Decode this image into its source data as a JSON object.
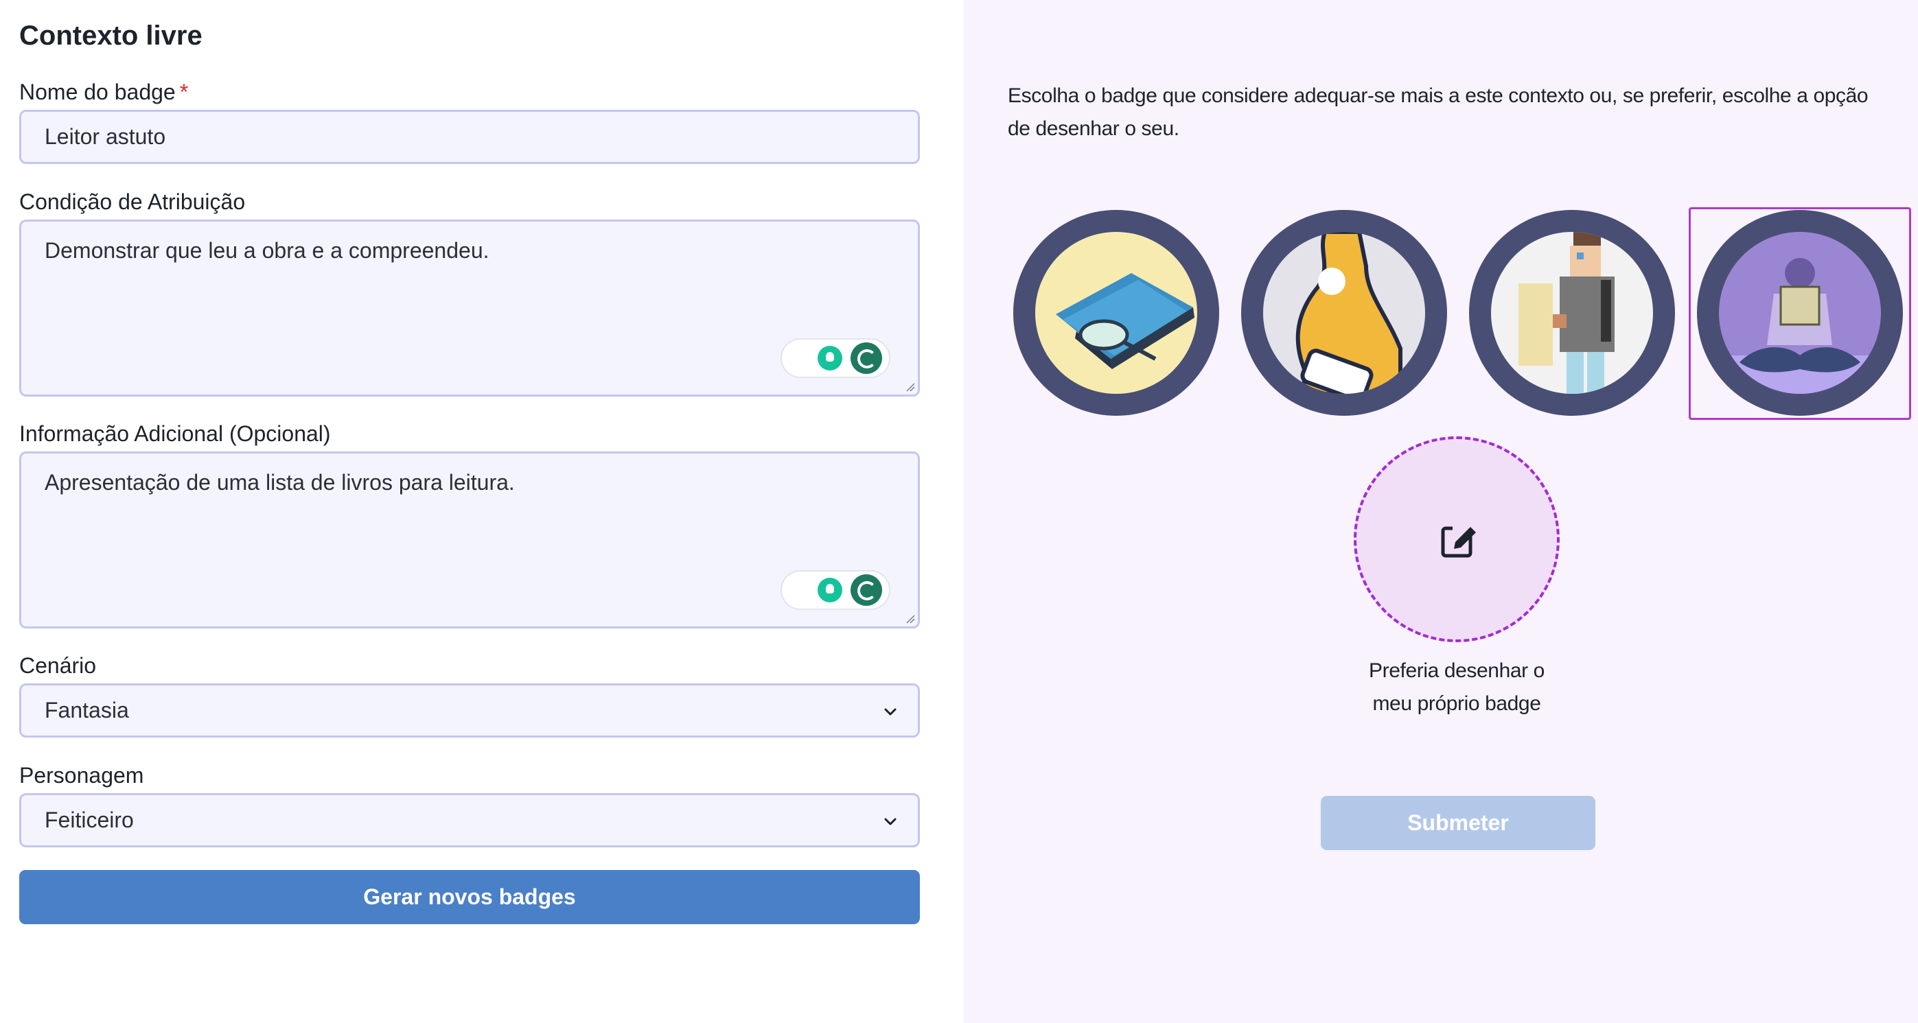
{
  "form": {
    "title": "Contexto livre",
    "badge_name": {
      "label": "Nome do badge",
      "required_mark": "*",
      "value": "Leitor astuto"
    },
    "condition": {
      "label": "Condição de Atribuição",
      "value": "Demonstrar que leu a obra e a compreendeu."
    },
    "additional_info": {
      "label": "Informação Adicional (Opcional)",
      "value": "Apresentação de uma lista de livros para leitura."
    },
    "scenario": {
      "label": "Cenário",
      "selected": "Fantasia"
    },
    "character": {
      "label": "Personagem",
      "selected": "Feiticeiro"
    },
    "generate_button": "Gerar novos badges"
  },
  "badges": {
    "instructions": "Escolha o badge que considere adequar-se mais a este contexto ou, se preferir, escolhe a opção de desenhar o seu.",
    "options": [
      {
        "name": "badge-book-magnifier",
        "ring_color": "#494e75",
        "bg_color": "#f7ebb0"
      },
      {
        "name": "badge-person-phone",
        "ring_color": "#494e75",
        "bg_color": "#e4e3ea"
      },
      {
        "name": "badge-pixel-person",
        "ring_color": "#494e75",
        "bg_color": "#f2f2f2"
      },
      {
        "name": "badge-person-reading",
        "ring_color": "#494e75",
        "bg_color": "#9b86d3",
        "selected": true
      }
    ],
    "draw_own": {
      "caption_line1": "Preferia desenhar o",
      "caption_line2": "meu próprio badge",
      "icon": "edit-pencil-icon"
    },
    "submit_button": "Submeter"
  },
  "colors": {
    "primary_button": "#4a80c7",
    "disabled_button": "#b3c8e8",
    "selection_frame": "#b039c9",
    "right_panel_bg": "#f8f3fc",
    "required_mark": "#e0252b"
  }
}
